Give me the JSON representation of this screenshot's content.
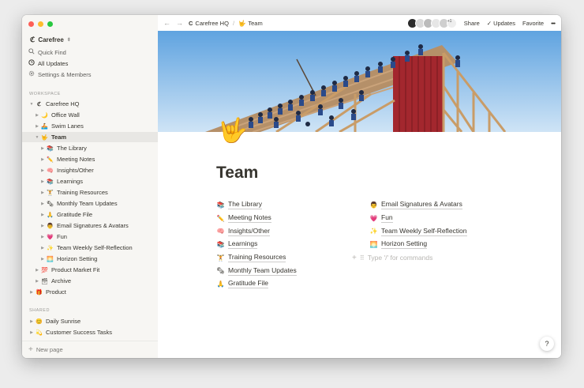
{
  "sidebar": {
    "workspace": "Carefree",
    "nav": [
      {
        "label": "Quick Find",
        "icon": "search-icon"
      },
      {
        "label": "All Updates",
        "icon": "clock-icon"
      },
      {
        "label": "Settings & Members",
        "icon": "gear-icon"
      }
    ],
    "workspace_label": "WORKSPACE",
    "tree": [
      {
        "label": "Carefree HQ",
        "emoji": "C",
        "level": 0,
        "open": true,
        "bold": false
      },
      {
        "label": "Office Wall",
        "emoji": "🌙",
        "level": 1
      },
      {
        "label": "Swim Lanes",
        "emoji": "🚣",
        "level": 1
      },
      {
        "label": "Team",
        "emoji": "🤟",
        "level": 1,
        "open": true,
        "selected": true,
        "bold": true
      },
      {
        "label": "The Library",
        "emoji": "📚",
        "level": 2
      },
      {
        "label": "Meeting Notes",
        "emoji": "✏️",
        "level": 2
      },
      {
        "label": "Insights/Other",
        "emoji": "🧠",
        "level": 2
      },
      {
        "label": "Learnings",
        "emoji": "📚",
        "level": 2
      },
      {
        "label": "Training Resources",
        "emoji": "🏋",
        "level": 2
      },
      {
        "label": "Monthly Team Updates",
        "emoji": "🗞",
        "level": 2
      },
      {
        "label": "Gratitude File",
        "emoji": "🙏",
        "level": 2
      },
      {
        "label": "Email Signatures & Avatars",
        "emoji": "👨",
        "level": 2
      },
      {
        "label": "Fun",
        "emoji": "💗",
        "level": 2
      },
      {
        "label": "Team Weekly Self-Reflection",
        "emoji": "✨",
        "level": 2
      },
      {
        "label": "Horizon Setting",
        "emoji": "🌅",
        "level": 2
      },
      {
        "label": "Product Market Fit",
        "emoji": "💯",
        "level": 1
      },
      {
        "label": "Archive",
        "emoji": "🗃",
        "level": 1
      },
      {
        "label": "Product",
        "emoji": "🎁",
        "level": 0
      }
    ],
    "shared_label": "SHARED",
    "shared": [
      {
        "label": "Daily Sunrise",
        "emoji": "😊"
      },
      {
        "label": "Customer Success Tasks",
        "emoji": "💫"
      }
    ],
    "new_page": "New page"
  },
  "topbar": {
    "crumb_root": "Carefree HQ",
    "crumb_root_icon": "C",
    "crumb_page": "Team",
    "crumb_page_icon": "🤟",
    "share": "Share",
    "updates": "Updates",
    "favorite": "Favorite",
    "more": "•••",
    "avatar_count": "+1"
  },
  "page": {
    "icon": "🤟",
    "title": "Team",
    "col1": [
      {
        "emoji": "📚",
        "label": "The Library"
      },
      {
        "emoji": "✏️",
        "label": "Meeting Notes"
      },
      {
        "emoji": "🧠",
        "label": "Insights/Other"
      },
      {
        "emoji": "📚",
        "label": "Learnings"
      },
      {
        "emoji": "🏋",
        "label": "Training Resources"
      },
      {
        "emoji": "🗞",
        "label": "Monthly Team Updates"
      },
      {
        "emoji": "🙏",
        "label": "Gratitude File"
      }
    ],
    "col2": [
      {
        "emoji": "👨",
        "label": "Email Signatures & Avatars"
      },
      {
        "emoji": "💗",
        "label": "Fun"
      },
      {
        "emoji": "✨",
        "label": "Team Weekly Self-Reflection"
      },
      {
        "emoji": "🌅",
        "label": "Horizon Setting"
      }
    ],
    "command_placeholder": "Type '/' for commands"
  },
  "help": "?"
}
